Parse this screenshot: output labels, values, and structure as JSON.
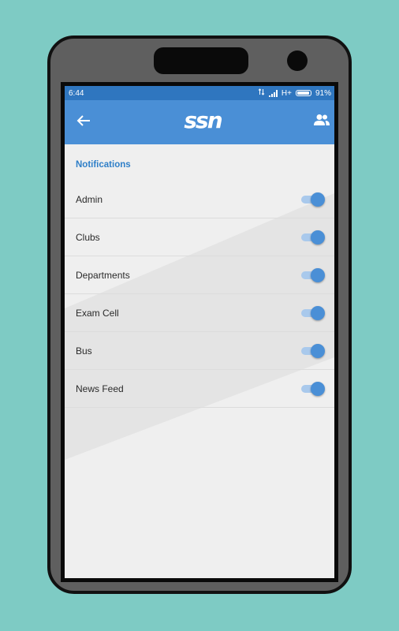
{
  "status_bar": {
    "time": "6:44",
    "data_icon": "data-transfer-icon",
    "signal_icon": "signal-icon",
    "network": "H+",
    "battery_icon": "battery-icon",
    "battery_percent": "91%",
    "battery_level": 0.91
  },
  "app_bar": {
    "back_icon": "back-arrow-icon",
    "logo_text": "ssn",
    "people_icon": "people-icon"
  },
  "settings": {
    "section_title": "Notifications",
    "items": [
      {
        "label": "Admin",
        "enabled": true
      },
      {
        "label": "Clubs",
        "enabled": true
      },
      {
        "label": "Departments",
        "enabled": true
      },
      {
        "label": "Exam Cell",
        "enabled": true
      },
      {
        "label": "Bus",
        "enabled": true
      },
      {
        "label": "News Feed",
        "enabled": true
      }
    ]
  },
  "colors": {
    "background": "#7ecbc4",
    "status_bar": "#2f76bf",
    "app_bar": "#4a8fd6",
    "accent": "#2f7fc8",
    "switch_track": "#a9c9ec",
    "switch_thumb": "#4a8fd6",
    "screen": "#efefef"
  }
}
